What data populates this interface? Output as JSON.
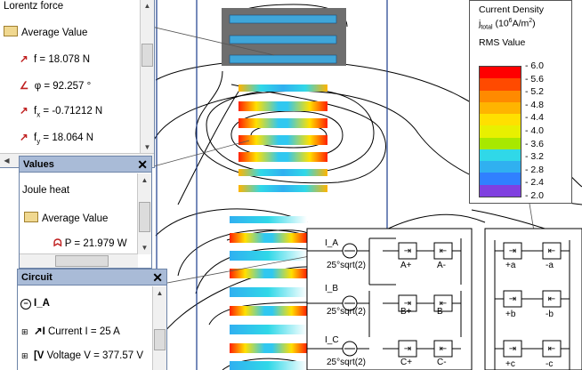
{
  "panel_lorentz": {
    "title": "Lorentz force",
    "folder": "Average Value",
    "items": [
      {
        "main": "f = 18.078 N",
        "sub": ""
      },
      {
        "main": "φ = 92.257 °",
        "sub": ""
      },
      {
        "pre": "f",
        "sub": "x",
        "post": " = -0.71212 N"
      },
      {
        "pre": "f",
        "sub": "y",
        "post": " = 18.064 N"
      }
    ]
  },
  "panel_values": {
    "title": "Values",
    "label": "Joule heat",
    "folder": "Average Value",
    "item": "P = 21.979 W"
  },
  "panel_circuit": {
    "title": "Circuit",
    "root": "I_A",
    "items": [
      "Current I = 25 A",
      "Voltage V = 377.57 V"
    ]
  },
  "legend": {
    "title_line1": "Current Density",
    "title_pre": "j",
    "title_sub": "total",
    "title_post": " (10",
    "title_exp": "6",
    "title_unit": "A/m",
    "title_exp2": "2",
    "title_end": ")",
    "subtitle": "RMS Value",
    "ticks": [
      "6.0",
      "5.6",
      "5.2",
      "4.8",
      "4.4",
      "4.0",
      "3.6",
      "3.2",
      "2.8",
      "2.4",
      "2.0"
    ],
    "colors": [
      "#ff0000",
      "#ff4a00",
      "#ff8a00",
      "#ffb400",
      "#ffe000",
      "#e8f000",
      "#a8e800",
      "#30d8e8",
      "#30b0f0",
      "#3080ff",
      "#8040e0"
    ]
  },
  "circuit": {
    "sources": [
      {
        "name": "I_A",
        "value": "25°sqrt(2)"
      },
      {
        "name": "I_B",
        "value": "25°sqrt(2)"
      },
      {
        "name": "I_C",
        "value": "25°sqrt(2)"
      }
    ],
    "coils_left": [
      {
        "a": "A+",
        "b": "A-"
      },
      {
        "a": "B+",
        "b": "B-"
      },
      {
        "a": "C+",
        "b": "C-"
      }
    ],
    "coils_right": [
      {
        "a": "+a",
        "b": "-a"
      },
      {
        "a": "+b",
        "b": "-b"
      },
      {
        "a": "+c",
        "b": "-c"
      }
    ]
  }
}
